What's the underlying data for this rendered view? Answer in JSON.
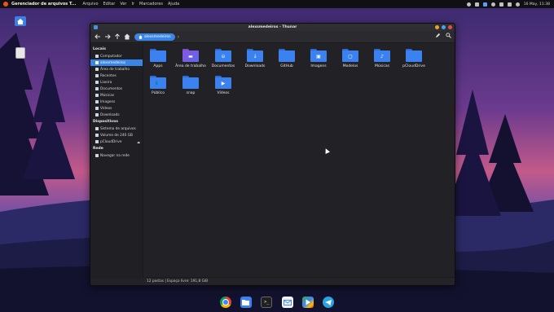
{
  "topbar": {
    "app_title": "Gerenciador de arquivos T...",
    "menu": [
      "Arquivo",
      "Editar",
      "Ver",
      "Ir",
      "Marcadores",
      "Ajuda"
    ],
    "clock": "16 May, 11:38"
  },
  "desktop": {
    "home_label": "",
    "trash_label": ""
  },
  "window": {
    "title": "alexsmedeiros - Thunar",
    "path_button": "alexsmedeiros"
  },
  "sidebar": {
    "sections": [
      {
        "title": "Locais",
        "items": [
          {
            "label": "Computador",
            "icon": "computer-icon",
            "active": false
          },
          {
            "label": "alexsmedeiros",
            "icon": "home-icon",
            "active": true
          },
          {
            "label": "Área de trabalho",
            "icon": "desktop-icon",
            "active": false
          },
          {
            "label": "Recentes",
            "icon": "recent-icon",
            "active": false
          },
          {
            "label": "Lixeira",
            "icon": "trash-icon",
            "active": false
          },
          {
            "label": "Documentos",
            "icon": "folder-icon",
            "active": false
          },
          {
            "label": "Músicas",
            "icon": "folder-icon",
            "active": false
          },
          {
            "label": "Imagens",
            "icon": "folder-icon",
            "active": false
          },
          {
            "label": "Vídeos",
            "icon": "folder-icon",
            "active": false
          },
          {
            "label": "Downloads",
            "icon": "folder-icon",
            "active": false
          }
        ]
      },
      {
        "title": "Dispositivos",
        "items": [
          {
            "label": "Sistema de arquivos",
            "icon": "drive-icon",
            "active": false
          },
          {
            "label": "Volume de 240 GB",
            "icon": "drive-icon",
            "active": false
          },
          {
            "label": "pCloudDrive",
            "icon": "drive-icon",
            "active": false,
            "eject": true
          }
        ]
      },
      {
        "title": "Rede",
        "items": [
          {
            "label": "Navegar na rede",
            "icon": "network-icon",
            "active": false
          }
        ]
      }
    ]
  },
  "files": [
    {
      "name": "Apps",
      "glyph": "",
      "style": "blue"
    },
    {
      "name": "Área de trabalho",
      "glyph": "▬",
      "style": "purple"
    },
    {
      "name": "Documentos",
      "glyph": "⊝",
      "style": "blue"
    },
    {
      "name": "Downloads",
      "glyph": "↓",
      "style": "blue"
    },
    {
      "name": "GitHub",
      "glyph": "",
      "style": "blue"
    },
    {
      "name": "Imagens",
      "glyph": "▣",
      "style": "blue"
    },
    {
      "name": "Modelos",
      "glyph": "▢",
      "style": "blue"
    },
    {
      "name": "Músicas",
      "glyph": "♪",
      "style": "blue"
    },
    {
      "name": "pCloudDrive",
      "glyph": "",
      "style": "blue"
    },
    {
      "name": "Público",
      "glyph": "👥",
      "style": "blue"
    },
    {
      "name": "snap",
      "glyph": "",
      "style": "blue"
    },
    {
      "name": "Vídeos",
      "glyph": "▶",
      "style": "blue"
    }
  ],
  "statusbar": {
    "text": "12 pastas  |  Espaço livre: 191,8 GiB"
  },
  "colors": {
    "accent": "#3a86e6",
    "window_bg": "#222226",
    "folder": "#3b82f0"
  },
  "dock": {
    "terminal_glyph": ">_"
  }
}
